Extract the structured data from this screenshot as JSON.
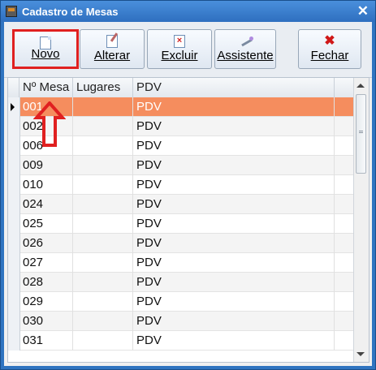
{
  "window": {
    "title": "Cadastro de Mesas",
    "close_glyph": "✕"
  },
  "toolbar": [
    {
      "key": "novo",
      "label": "Novo",
      "icon": "new-document-icon"
    },
    {
      "key": "alterar",
      "label": "Alterar",
      "icon": "edit-icon"
    },
    {
      "key": "excluir",
      "label": "Excluir",
      "icon": "delete-icon"
    },
    {
      "key": "assistente",
      "label": "Assistente",
      "icon": "wizard-icon"
    },
    {
      "key": "fechar",
      "label": "Fechar",
      "icon": "close-icon"
    }
  ],
  "grid": {
    "columns": [
      "Nº Mesa",
      "Lugares",
      "PDV"
    ],
    "rows": [
      {
        "mesa": "001",
        "lugares": "",
        "pdv": "PDV",
        "selected": true
      },
      {
        "mesa": "002",
        "lugares": "",
        "pdv": "PDV"
      },
      {
        "mesa": "006",
        "lugares": "",
        "pdv": "PDV"
      },
      {
        "mesa": "009",
        "lugares": "",
        "pdv": "PDV"
      },
      {
        "mesa": "010",
        "lugares": "",
        "pdv": "PDV"
      },
      {
        "mesa": "024",
        "lugares": "",
        "pdv": "PDV"
      },
      {
        "mesa": "025",
        "lugares": "",
        "pdv": "PDV"
      },
      {
        "mesa": "026",
        "lugares": "",
        "pdv": "PDV"
      },
      {
        "mesa": "027",
        "lugares": "",
        "pdv": "PDV"
      },
      {
        "mesa": "028",
        "lugares": "",
        "pdv": "PDV"
      },
      {
        "mesa": "029",
        "lugares": "",
        "pdv": "PDV"
      },
      {
        "mesa": "030",
        "lugares": "",
        "pdv": "PDV"
      },
      {
        "mesa": "031",
        "lugares": "",
        "pdv": "PDV"
      }
    ]
  },
  "colors": {
    "selected_row": "#f58d5e",
    "highlight": "#e02020",
    "title_bar": "#2e6fbf"
  }
}
